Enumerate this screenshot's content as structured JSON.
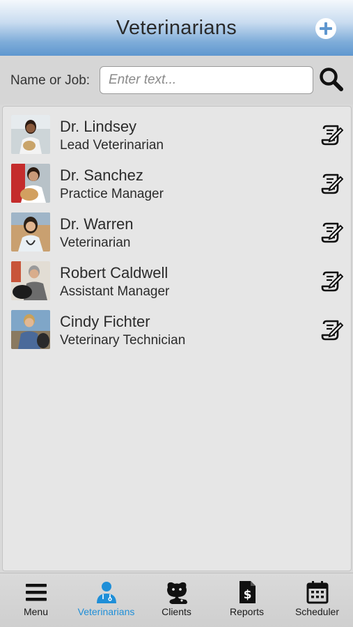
{
  "header": {
    "title": "Veterinarians",
    "add_icon": "plus-circle-icon"
  },
  "search": {
    "label": "Name or Job:",
    "placeholder": "Enter text...",
    "value": "",
    "icon": "magnifier-icon"
  },
  "veterinarians": [
    {
      "name": "Dr. Lindsey",
      "job": "Lead Veterinarian"
    },
    {
      "name": "Dr. Sanchez",
      "job": "Practice Manager"
    },
    {
      "name": "Dr. Warren",
      "job": "Veterinarian"
    },
    {
      "name": "Robert Caldwell",
      "job": "Assistant Manager"
    },
    {
      "name": "Cindy Fichter",
      "job": "Veterinary Technician"
    }
  ],
  "tabs": [
    {
      "label": "Menu",
      "icon": "hamburger-icon"
    },
    {
      "label": "Veterinarians",
      "icon": "doctor-icon",
      "active": true
    },
    {
      "label": "Clients",
      "icon": "pets-icon"
    },
    {
      "label": "Reports",
      "icon": "dollar-document-icon"
    },
    {
      "label": "Scheduler",
      "icon": "calendar-icon"
    }
  ],
  "colors": {
    "accent": "#1f8fd8",
    "header_bottom": "#5f97cf",
    "panel": "#e6e6e6"
  }
}
